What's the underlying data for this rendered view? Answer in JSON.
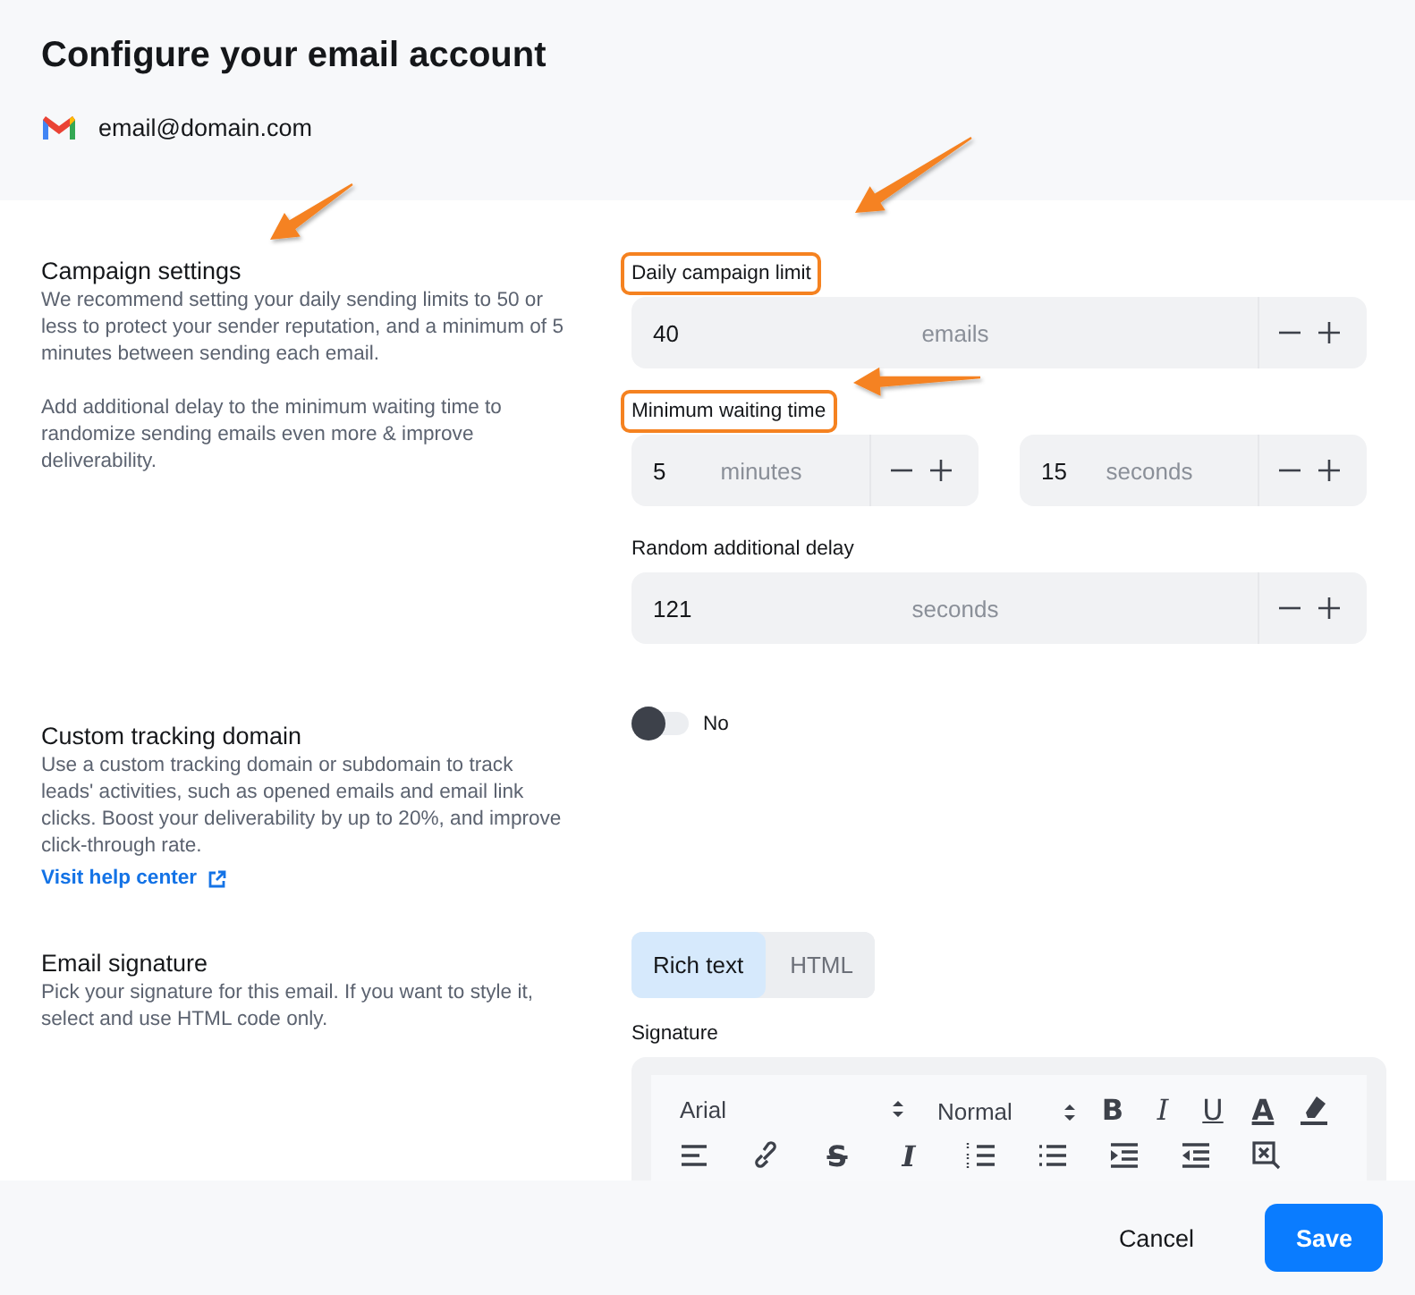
{
  "title": "Configure your email account",
  "account": {
    "email": "email@domain.com"
  },
  "sections": [
    {
      "kind": "campaign",
      "title": "Campaign settings",
      "paragraphs": [
        "We recommend setting your daily sending limits to 50 or less to protect your sender reputation, and a minimum of 5 minutes between sending each email.",
        "Add additional delay to the minimum waiting time to randomize sending emails even more & improve deliverability."
      ],
      "groups": [
        {
          "label": "Daily campaign limit",
          "highlighted": true,
          "inputs": [
            {
              "value": "40",
              "unit": "emails"
            }
          ]
        },
        {
          "label": "Minimum waiting time",
          "highlighted": true,
          "inputs": [
            {
              "value": "5",
              "unit": "minutes"
            },
            {
              "value": "15",
              "unit": "seconds"
            }
          ]
        },
        {
          "label": "Random additional delay",
          "highlighted": false,
          "inputs": [
            {
              "value": "121",
              "unit": "seconds"
            }
          ]
        }
      ]
    },
    {
      "kind": "tracking",
      "title": "Custom tracking domain",
      "paragraphs": [
        "Use a custom tracking domain or subdomain to track leads' activities, such as opened emails and email link clicks. Boost your deliverability by up to 20%, and improve click-through rate."
      ],
      "link": "Visit help center",
      "toggle": {
        "on": false,
        "label": "No"
      }
    },
    {
      "kind": "signature",
      "title": "Email signature",
      "paragraphs": [
        "Pick your signature for this email. If you want to style it, select and use HTML code only."
      ],
      "tabs": [
        {
          "label": "Rich text",
          "selected": true
        },
        {
          "label": "HTML",
          "selected": false
        }
      ],
      "editor": {
        "label": "Signature",
        "font": "Arial",
        "size": "Normal",
        "tools": [
          {
            "kind": "bold",
            "glyph": "B"
          },
          {
            "kind": "italic",
            "glyph": "I"
          },
          {
            "kind": "underline",
            "glyph": "U"
          },
          {
            "kind": "color",
            "glyph": "A"
          },
          {
            "kind": "highlight"
          }
        ],
        "tools2": [
          {
            "kind": "align"
          },
          {
            "kind": "link"
          },
          {
            "kind": "strike",
            "glyph": "S"
          },
          {
            "kind": "clear",
            "glyph": "I"
          },
          {
            "kind": "ordered"
          },
          {
            "kind": "bullets"
          },
          {
            "kind": "indent"
          },
          {
            "kind": "outdent"
          },
          {
            "kind": "image-remove"
          }
        ]
      }
    }
  ],
  "buttons": [
    {
      "kind": "secondary",
      "label": "Cancel"
    },
    {
      "kind": "primary",
      "label": "Save"
    }
  ]
}
